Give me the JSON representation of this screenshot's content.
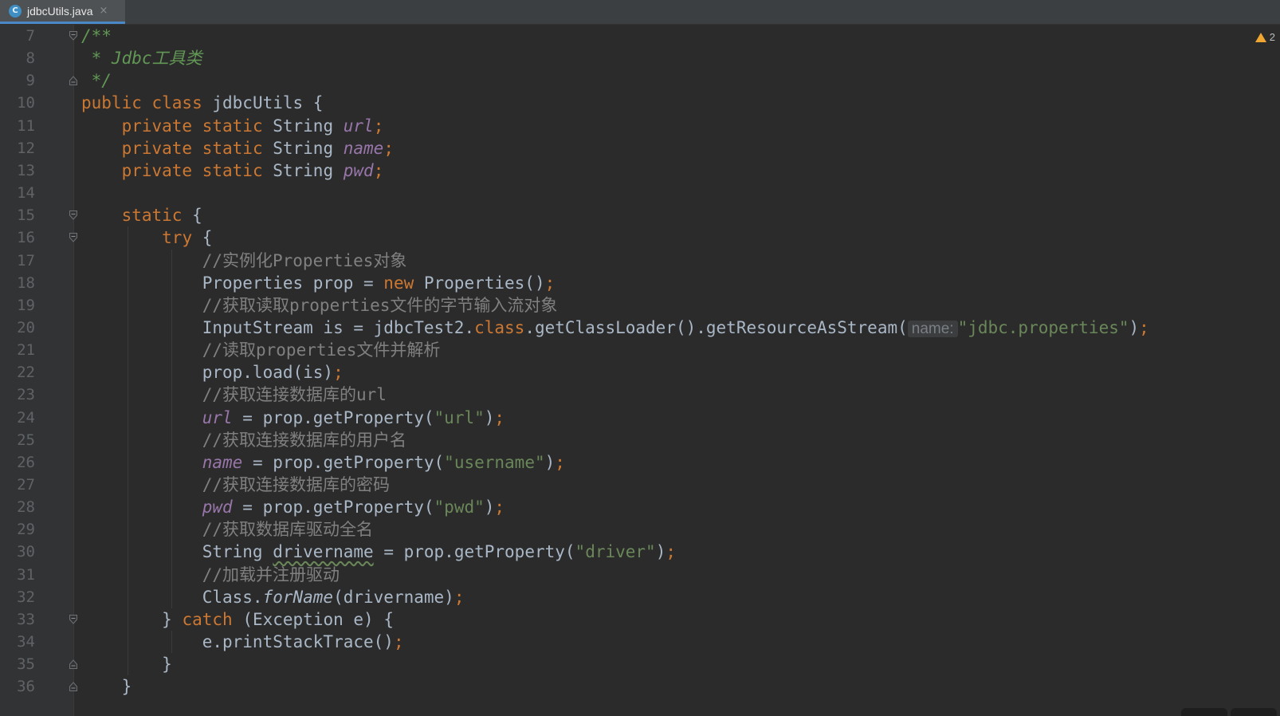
{
  "tab": {
    "icon_letter": "C",
    "label": "jdbcUtils.java",
    "close": "×"
  },
  "warnings": {
    "count": "2",
    "icon": "warning-icon"
  },
  "lines": [
    {
      "n": "7",
      "indent": 0,
      "tokens": [
        [
          "doc",
          "/**"
        ]
      ],
      "fold": "open"
    },
    {
      "n": "8",
      "indent": 0,
      "tokens": [
        [
          "doc",
          " * Jdbc工具类"
        ]
      ]
    },
    {
      "n": "9",
      "indent": 0,
      "tokens": [
        [
          "doc",
          " */"
        ]
      ],
      "fold": "close"
    },
    {
      "n": "10",
      "indent": 0,
      "tokens": [
        [
          "kw",
          "public class "
        ],
        [
          "p",
          "jdbcUtils {"
        ]
      ]
    },
    {
      "n": "11",
      "indent": 1,
      "tokens": [
        [
          "kw",
          "private static "
        ],
        [
          "p",
          "String "
        ],
        [
          "fld",
          "url"
        ],
        [
          "semi",
          ";"
        ]
      ]
    },
    {
      "n": "12",
      "indent": 1,
      "tokens": [
        [
          "kw",
          "private static "
        ],
        [
          "p",
          "String "
        ],
        [
          "fld",
          "name"
        ],
        [
          "semi",
          ";"
        ]
      ]
    },
    {
      "n": "13",
      "indent": 1,
      "tokens": [
        [
          "kw",
          "private static "
        ],
        [
          "p",
          "String "
        ],
        [
          "fld",
          "pwd"
        ],
        [
          "semi",
          ";"
        ]
      ]
    },
    {
      "n": "14",
      "indent": 0,
      "tokens": []
    },
    {
      "n": "15",
      "indent": 1,
      "tokens": [
        [
          "kw",
          "static "
        ],
        [
          "p",
          "{"
        ]
      ],
      "fold": "open"
    },
    {
      "n": "16",
      "indent": 2,
      "tokens": [
        [
          "kw",
          "try "
        ],
        [
          "p",
          "{"
        ]
      ],
      "fold": "open"
    },
    {
      "n": "17",
      "indent": 3,
      "tokens": [
        [
          "cmt",
          "//实例化Properties对象"
        ]
      ]
    },
    {
      "n": "18",
      "indent": 3,
      "tokens": [
        [
          "p",
          "Properties prop = "
        ],
        [
          "kw",
          "new "
        ],
        [
          "p",
          "Properties()"
        ],
        [
          "semi",
          ";"
        ]
      ]
    },
    {
      "n": "19",
      "indent": 3,
      "tokens": [
        [
          "cmt",
          "//获取读取properties文件的字节输入流对象"
        ]
      ]
    },
    {
      "n": "20",
      "indent": 3,
      "tokens": [
        [
          "p",
          "InputStream is = jdbcTest2."
        ],
        [
          "kw",
          "class"
        ],
        [
          "p",
          ".getClassLoader().getResourceAsStream("
        ],
        [
          "hint",
          "name:"
        ],
        [
          "str",
          "\"jdbc.properties\""
        ],
        [
          "p",
          ")"
        ],
        [
          "semi",
          ";"
        ]
      ]
    },
    {
      "n": "21",
      "indent": 3,
      "tokens": [
        [
          "cmt",
          "//读取properties文件并解析"
        ]
      ]
    },
    {
      "n": "22",
      "indent": 3,
      "tokens": [
        [
          "p",
          "prop.load(is)"
        ],
        [
          "semi",
          ";"
        ]
      ]
    },
    {
      "n": "23",
      "indent": 3,
      "tokens": [
        [
          "cmt",
          "//获取连接数据库的url"
        ]
      ]
    },
    {
      "n": "24",
      "indent": 3,
      "tokens": [
        [
          "fld",
          "url"
        ],
        [
          "p",
          " = prop.getProperty("
        ],
        [
          "str",
          "\"url\""
        ],
        [
          "p",
          ")"
        ],
        [
          "semi",
          ";"
        ]
      ]
    },
    {
      "n": "25",
      "indent": 3,
      "tokens": [
        [
          "cmt",
          "//获取连接数据库的用户名"
        ]
      ]
    },
    {
      "n": "26",
      "indent": 3,
      "tokens": [
        [
          "fld",
          "name"
        ],
        [
          "p",
          " = prop.getProperty("
        ],
        [
          "str",
          "\"username\""
        ],
        [
          "p",
          ")"
        ],
        [
          "semi",
          ";"
        ]
      ]
    },
    {
      "n": "27",
      "indent": 3,
      "tokens": [
        [
          "cmt",
          "//获取连接数据库的密码"
        ]
      ]
    },
    {
      "n": "28",
      "indent": 3,
      "tokens": [
        [
          "fld",
          "pwd"
        ],
        [
          "p",
          " = prop.getProperty("
        ],
        [
          "str",
          "\"pwd\""
        ],
        [
          "p",
          ")"
        ],
        [
          "semi",
          ";"
        ]
      ]
    },
    {
      "n": "29",
      "indent": 3,
      "tokens": [
        [
          "cmt",
          "//获取数据库驱动全名"
        ]
      ]
    },
    {
      "n": "30",
      "indent": 3,
      "tokens": [
        [
          "p",
          "String "
        ],
        [
          "typo",
          "drivername"
        ],
        [
          "p",
          " = prop.getProperty("
        ],
        [
          "str",
          "\"driver\""
        ],
        [
          "p",
          ")"
        ],
        [
          "semi",
          ";"
        ]
      ]
    },
    {
      "n": "31",
      "indent": 3,
      "tokens": [
        [
          "cmt",
          "//加载并注册驱动"
        ]
      ]
    },
    {
      "n": "32",
      "indent": 3,
      "tokens": [
        [
          "p",
          "Class."
        ],
        [
          "stat",
          "forName"
        ],
        [
          "p",
          "(drivername)"
        ],
        [
          "semi",
          ";"
        ]
      ]
    },
    {
      "n": "33",
      "indent": 2,
      "tokens": [
        [
          "p",
          "} "
        ],
        [
          "kw",
          "catch "
        ],
        [
          "p",
          "(Exception e) {"
        ]
      ],
      "fold": "open"
    },
    {
      "n": "34",
      "indent": 3,
      "tokens": [
        [
          "p",
          "e.printStackTrace()"
        ],
        [
          "semi",
          ";"
        ]
      ]
    },
    {
      "n": "35",
      "indent": 2,
      "tokens": [
        [
          "p",
          "}"
        ]
      ],
      "fold": "close"
    },
    {
      "n": "36",
      "indent": 1,
      "tokens": [
        [
          "p",
          "}"
        ]
      ],
      "fold": "close"
    }
  ]
}
